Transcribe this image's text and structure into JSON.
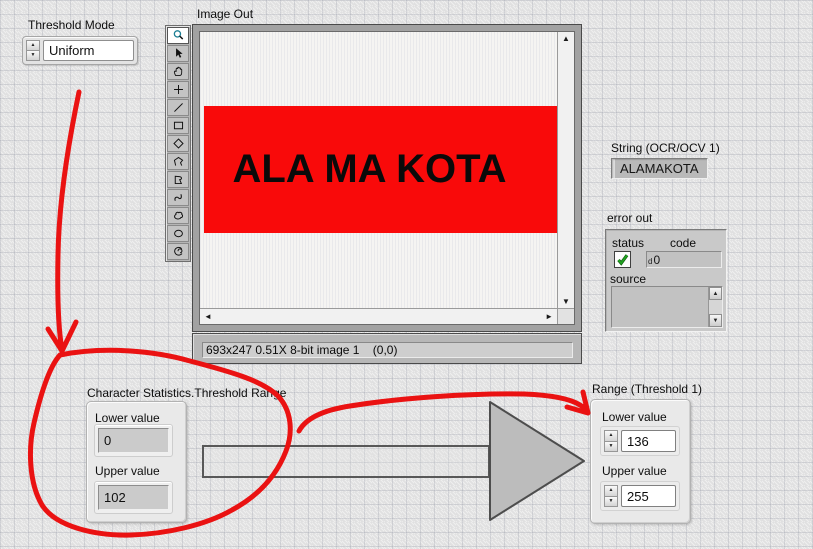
{
  "threshold_mode": {
    "label": "Threshold Mode",
    "value": "Uniform"
  },
  "image_display": {
    "label": "Image Out",
    "selected_tool": "zoom-tool",
    "tools": [
      "zoom-tool",
      "cursor-tool",
      "pan-tool",
      "point-tool",
      "line-tool",
      "rectangle-tool",
      "rotated-rectangle-tool",
      "polygon-tool",
      "free-region-tool",
      "broken-line-tool",
      "freehand-region-tool",
      "oval-tool",
      "annulus-tool"
    ],
    "image_text": "ALA MA KOTA",
    "band_color": "#f90a0a",
    "status_text": "693x247 0.51X 8-bit image 1    (0,0)"
  },
  "ocr_string": {
    "label": "String (OCR/OCV 1)",
    "value": "ALAMAKOTA"
  },
  "error_out": {
    "label": "error out",
    "status": {
      "label": "status",
      "checked": true,
      "check_color": "#21a321"
    },
    "code": {
      "label": "code",
      "radix": "d",
      "value": "0"
    },
    "source": {
      "label": "source",
      "value": ""
    }
  },
  "character_statistics": {
    "label": "Character Statistics.Threshold Range",
    "lower": {
      "label": "Lower value",
      "value": "0"
    },
    "upper": {
      "label": "Upper value",
      "value": "102"
    }
  },
  "range_threshold": {
    "label": "Range (Threshold 1)",
    "lower": {
      "label": "Lower value",
      "value": "136"
    },
    "upper": {
      "label": "Upper value",
      "value": "255"
    }
  },
  "annotations": {
    "color": "#ea1212"
  }
}
